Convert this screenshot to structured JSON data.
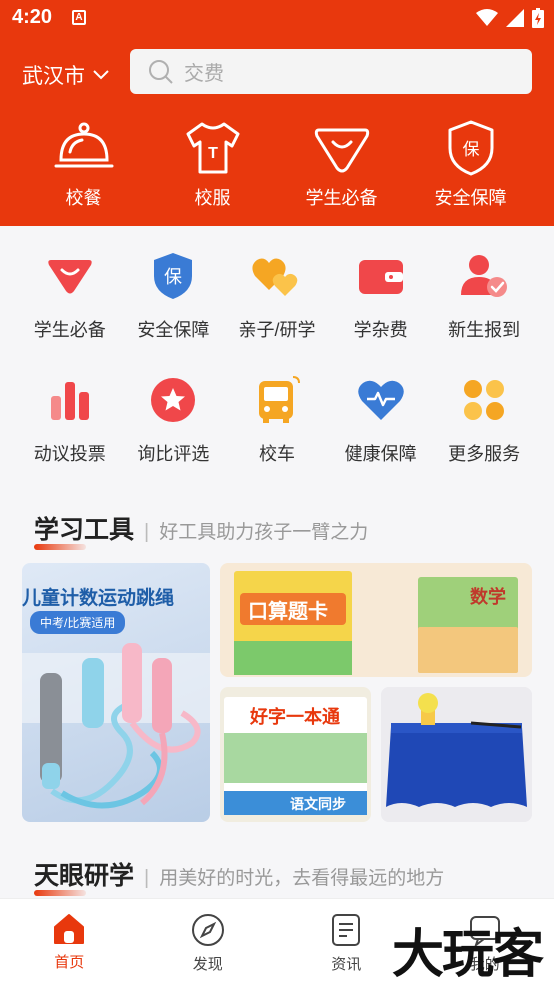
{
  "status": {
    "time": "4:20",
    "app_badge": "A"
  },
  "header": {
    "city": "武汉市",
    "search_placeholder": "交费",
    "top_categories": [
      {
        "label": "校餐",
        "icon": "dish-cover-icon"
      },
      {
        "label": "校服",
        "icon": "tshirt-icon"
      },
      {
        "label": "学生必备",
        "icon": "bag-icon"
      },
      {
        "label": "安全保障",
        "icon": "shield-icon"
      }
    ]
  },
  "services": [
    {
      "label": "学生必备",
      "icon": "bag-icon",
      "color": "#f0474a"
    },
    {
      "label": "安全保障",
      "icon": "shield-icon",
      "color": "#3a7bd5"
    },
    {
      "label": "亲子/研学",
      "icon": "hearts-icon",
      "color": "#f5a623"
    },
    {
      "label": "学杂费",
      "icon": "wallet-icon",
      "color": "#f0474a"
    },
    {
      "label": "新生报到",
      "icon": "user-check-icon",
      "color": "#f0474a"
    },
    {
      "label": "动议投票",
      "icon": "bar-chart-icon",
      "color": "#f0474a"
    },
    {
      "label": "询比评选",
      "icon": "star-icon",
      "color": "#f0474a"
    },
    {
      "label": "校车",
      "icon": "bus-icon",
      "color": "#f5a623"
    },
    {
      "label": "健康保障",
      "icon": "heart-pulse-icon",
      "color": "#3a7bd5"
    },
    {
      "label": "更多服务",
      "icon": "grid-icon",
      "color": "#f5a623"
    }
  ],
  "study_tools": {
    "title": "学习工具",
    "subtitle": "好工具助力孩子一臂之力",
    "rope_banner_title": "儿童计数运动跳绳",
    "rope_banner_tag": "中考/比赛适用",
    "book1_title": "口算题卡",
    "book2_title": "数学",
    "workbook_title": "好字一本通",
    "workbook_strip": "语文同步"
  },
  "research": {
    "title": "天眼研学",
    "subtitle": "用美好的时光，去看得最远的地方"
  },
  "tabbar": [
    {
      "label": "首页",
      "icon": "home-icon",
      "active": true
    },
    {
      "label": "发现",
      "icon": "compass-icon",
      "active": false
    },
    {
      "label": "资讯",
      "icon": "document-icon",
      "active": false
    },
    {
      "label": "我的",
      "icon": "chat-icon",
      "active": false
    }
  ],
  "watermark": "大玩客",
  "colors": {
    "brand": "#e8380d",
    "red": "#f0474a",
    "blue": "#3a7bd5",
    "orange": "#f5a623"
  }
}
